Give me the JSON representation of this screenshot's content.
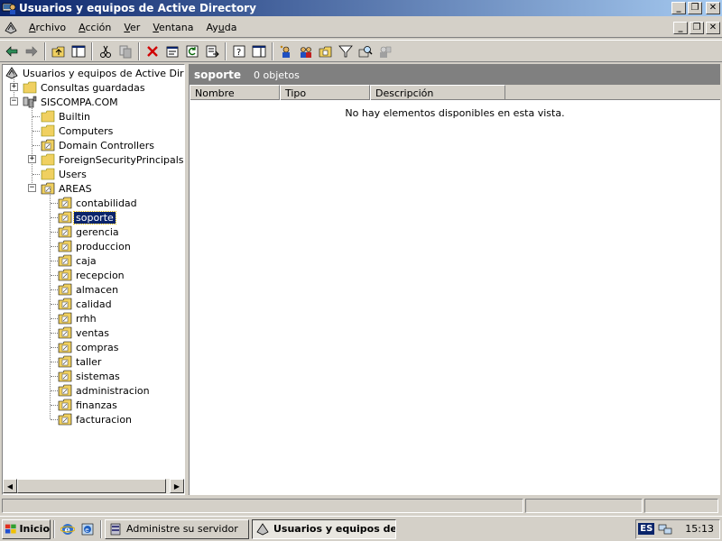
{
  "window": {
    "title": "Usuarios y equipos de Active Directory"
  },
  "menu": [
    {
      "label": "Archivo",
      "underline": 0
    },
    {
      "label": "Acción",
      "underline": 0
    },
    {
      "label": "Ver",
      "underline": 0
    },
    {
      "label": "Ventana",
      "underline": 0
    },
    {
      "label": "Ayuda",
      "underline": 2
    }
  ],
  "toolbar": {
    "icons": [
      "back-icon",
      "forward-icon",
      "up-one-level-icon",
      "show-hide-tree-icon",
      "cut-icon",
      "copy-icon",
      "delete-icon",
      "properties-icon",
      "refresh-icon",
      "export-list-icon",
      "help-icon",
      "show-hide-action-pane-icon",
      "new-user-icon",
      "new-group-icon",
      "new-ou-icon",
      "filter-icon",
      "find-icon",
      "add-to-group-icon"
    ]
  },
  "tree": {
    "root_label": "Usuarios y equipos de Active Director",
    "saved_queries": "Consultas guardadas",
    "domain": "SISCOMPA.COM",
    "domain_children": [
      "Builtin",
      "Computers",
      "Domain Controllers",
      "ForeignSecurityPrincipals",
      "Users",
      "AREAS"
    ],
    "areas_children": [
      "contabilidad",
      "soporte",
      "gerencia",
      "produccion",
      "caja",
      "recepcion",
      "almacen",
      "calidad",
      "rrhh",
      "ventas",
      "compras",
      "taller",
      "sistemas",
      "administracion",
      "finanzas",
      "facturacion"
    ],
    "selected": "soporte"
  },
  "details": {
    "title": "soporte",
    "count": "0 objetos",
    "columns": [
      "Nombre",
      "Tipo",
      "Descripción"
    ],
    "empty_message": "No hay elementos disponibles en esta vista."
  },
  "taskbar": {
    "start_label": "Inicio",
    "tasks": [
      {
        "label": "Administre su servidor",
        "active": false
      },
      {
        "label": "Usuarios y equipos de...",
        "active": true
      }
    ],
    "language": "ES",
    "clock": "15:13"
  }
}
